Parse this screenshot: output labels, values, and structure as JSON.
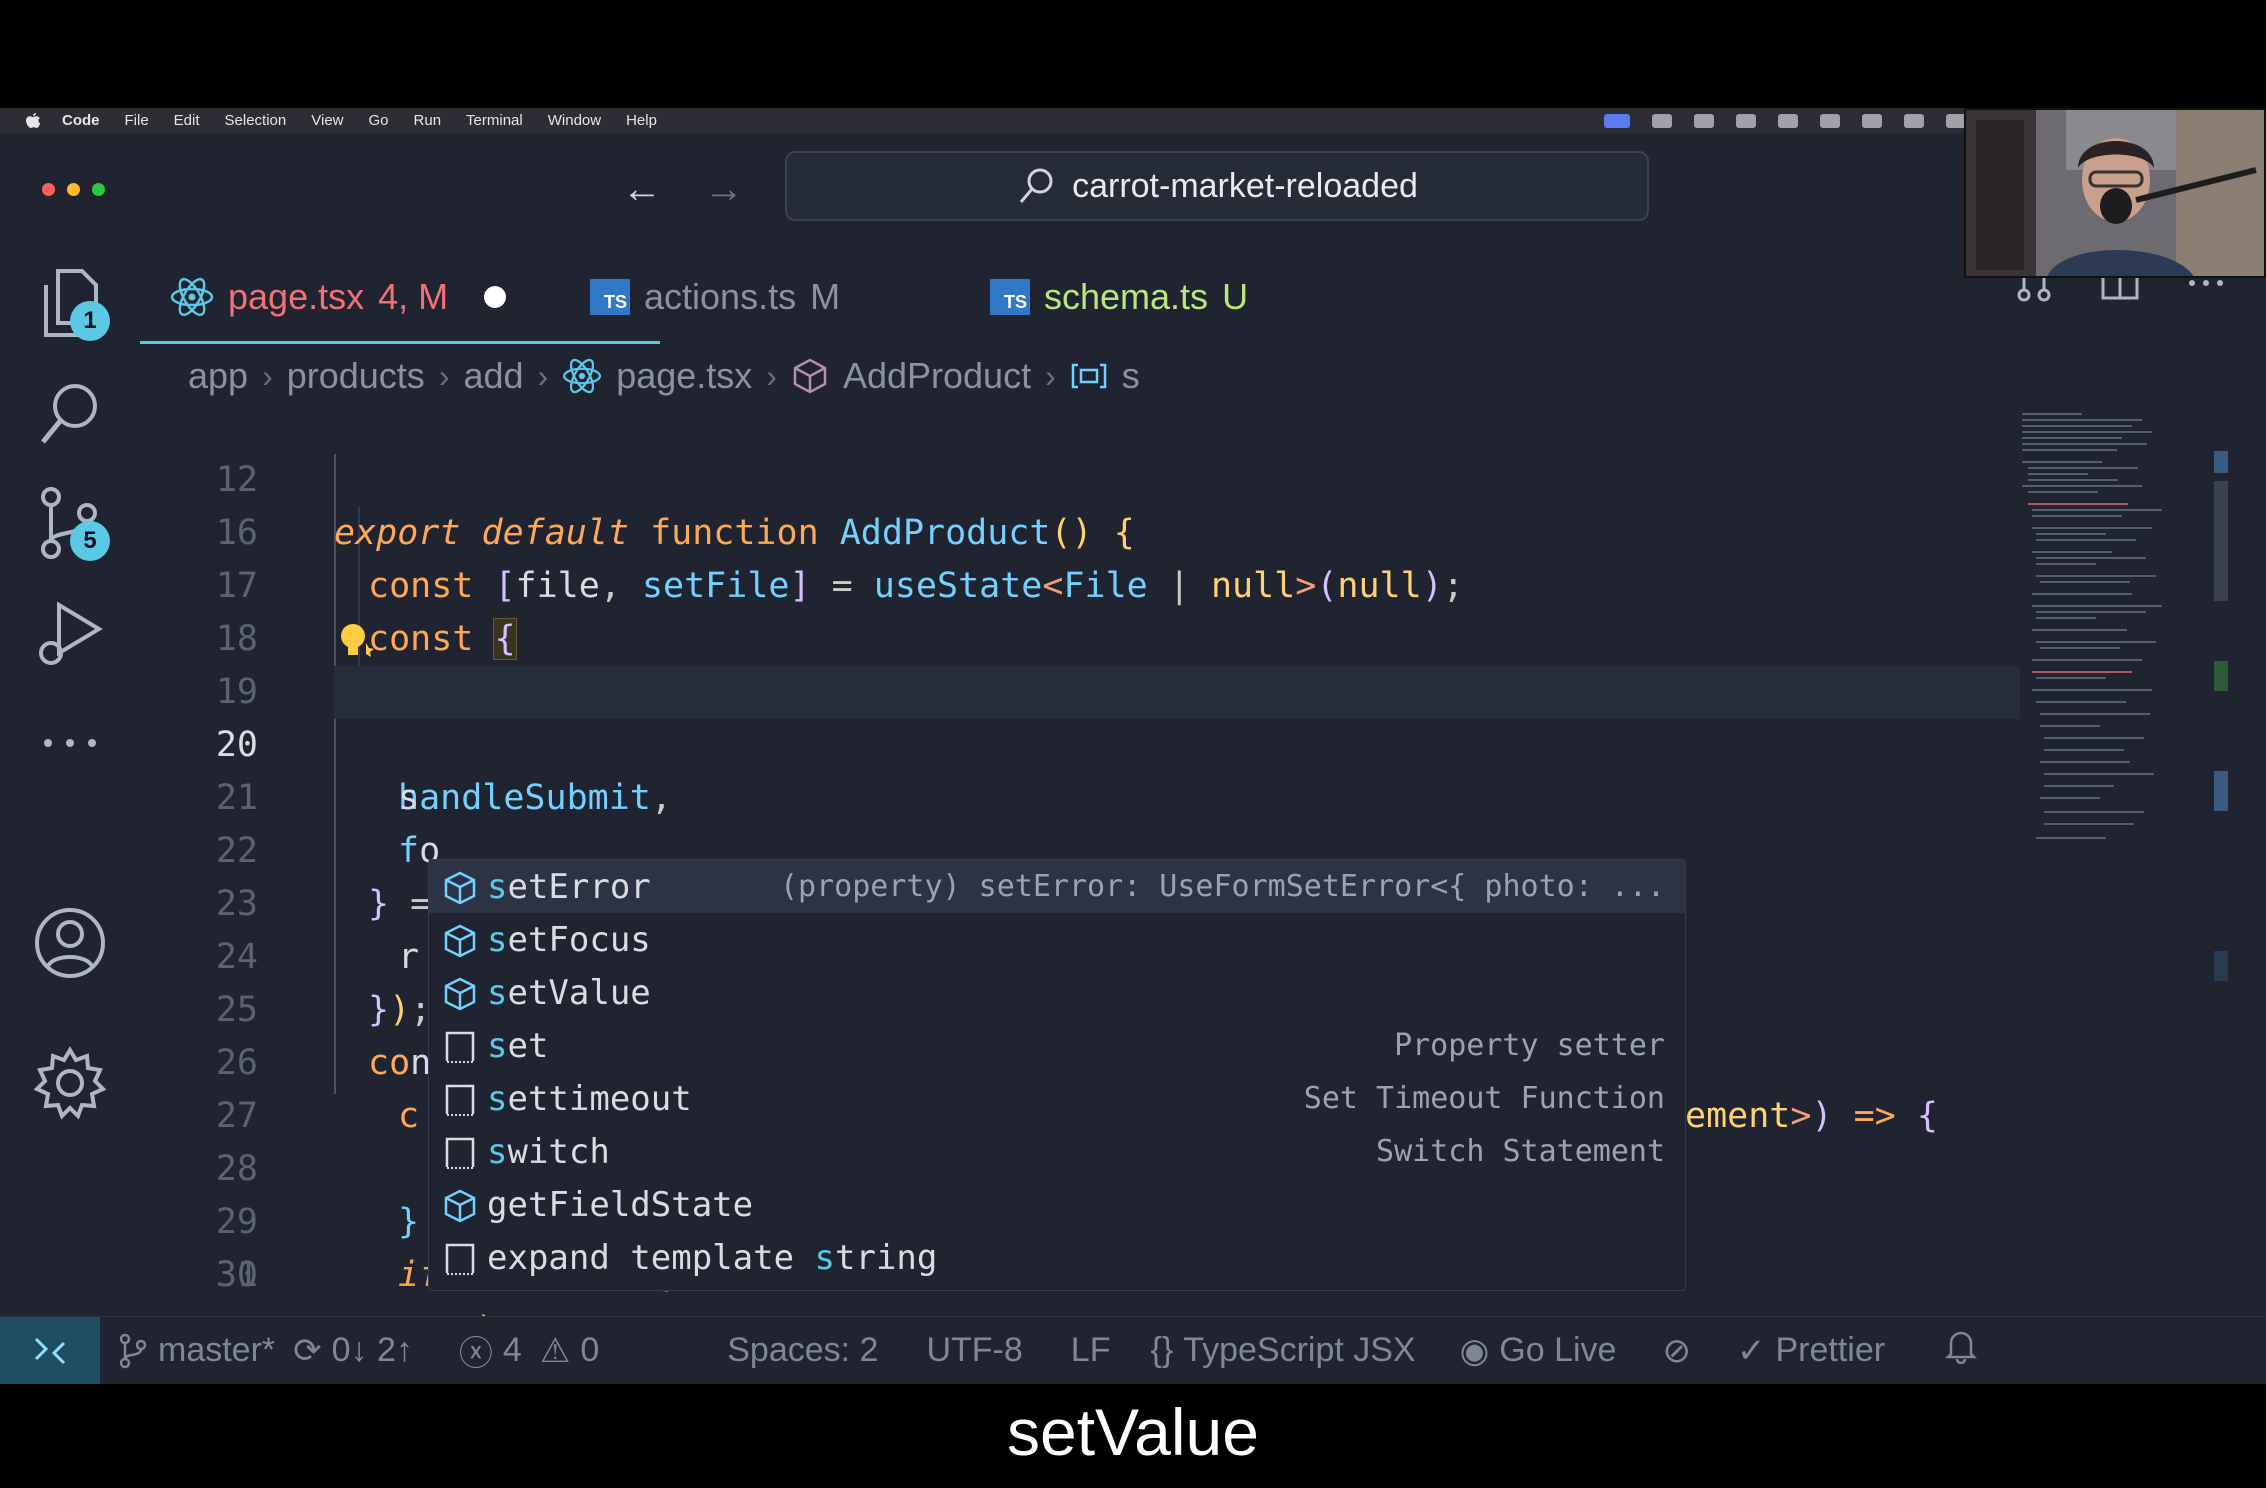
{
  "menubar": {
    "items": [
      "Code",
      "File",
      "Edit",
      "Selection",
      "View",
      "Go",
      "Run",
      "Terminal",
      "Window",
      "Help"
    ]
  },
  "titlebar": {
    "search_text": "carrot-market-reloaded"
  },
  "activity": {
    "explorer_badge": "1",
    "scm_badge": "5"
  },
  "tabs": [
    {
      "label": "page.tsx",
      "status": "4, M",
      "icon": "react-icon",
      "color": "#f07178"
    },
    {
      "label": "actions.ts",
      "status": "M",
      "icon": "ts-icon",
      "color": "#8a91a3"
    },
    {
      "label": "schema.ts",
      "status": "U",
      "icon": "ts-icon",
      "color": "#bae67e"
    }
  ],
  "ts_badge": "TS",
  "breadcrumb": {
    "items": [
      "app",
      "products",
      "add",
      "page.tsx",
      "AddProduct",
      "s"
    ]
  },
  "editor": {
    "lines": [
      {
        "n": "12"
      },
      {
        "n": "16"
      },
      {
        "n": "17"
      },
      {
        "n": "18"
      },
      {
        "n": "19"
      },
      {
        "n": "20"
      },
      {
        "n": "21"
      },
      {
        "n": "22"
      },
      {
        "n": "23"
      },
      {
        "n": "24"
      },
      {
        "n": "25"
      },
      {
        "n": "26"
      },
      {
        "n": "27"
      },
      {
        "n": "28"
      },
      {
        "n": "29"
      },
      {
        "n": "30"
      },
      {
        "n": "31"
      }
    ]
  },
  "suggest": {
    "items": [
      {
        "label": "setError",
        "detail": "(property) setError: UseFormSetError<{ photo: ...",
        "kind": "property"
      },
      {
        "label": "setFocus",
        "detail": "",
        "kind": "property"
      },
      {
        "label": "setValue",
        "detail": "",
        "kind": "property"
      },
      {
        "label": "set",
        "detail": "Property setter",
        "kind": "snippet"
      },
      {
        "label": "settimeout",
        "detail": "Set Timeout Function",
        "kind": "snippet"
      },
      {
        "label": "switch",
        "detail": "Switch Statement",
        "kind": "snippet"
      },
      {
        "label": "getFieldState",
        "detail": "",
        "kind": "property"
      },
      {
        "label": "expand template string",
        "detail": "",
        "kind": "snippet"
      }
    ]
  },
  "statusbar": {
    "branch": "master*",
    "sync": "0↓ 2↑",
    "errors": "4",
    "warnings": "0",
    "spaces": "Spaces: 2",
    "encoding": "UTF-8",
    "eol": "LF",
    "language": "TypeScript JSX",
    "golive": "Go Live",
    "prettier": "Prettier"
  },
  "caption": "setValue",
  "colors": {
    "accent": "#5bc8e6",
    "background": "#1f2430",
    "keyword": "#ffa759",
    "function": "#73d0ff"
  }
}
